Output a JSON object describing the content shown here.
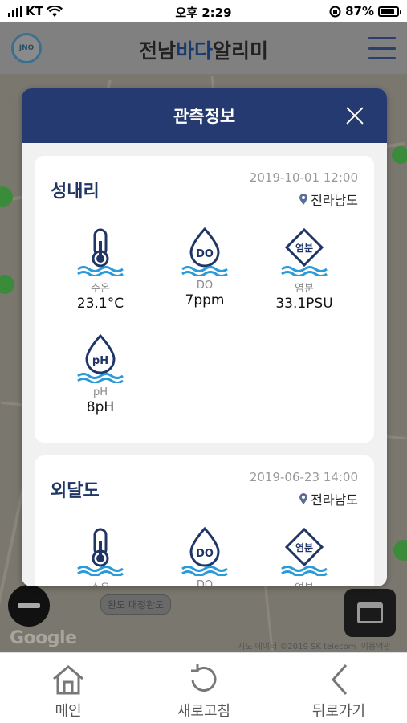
{
  "status_bar": {
    "carrier": "KT",
    "time": "오후 2:29",
    "battery": "87%",
    "battery_level": 0.87
  },
  "app": {
    "title_part1": "전남",
    "title_part2": "바다",
    "title_part3": "알리미",
    "logo_text": "JNO"
  },
  "map": {
    "google": "Google",
    "copyright": "지도 데이터 ©2019 SK telecom",
    "terms": "이용약관",
    "location_label": "완도 대청완도"
  },
  "modal": {
    "title": "관측정보",
    "cards": [
      {
        "name": "성내리",
        "datetime": "2019-10-01 12:00",
        "region": "전라남도",
        "metrics": [
          {
            "icon": "thermometer-icon",
            "label": "수온",
            "value": "23.1°C"
          },
          {
            "icon": "do-drop-icon",
            "label": "DO",
            "value": "7ppm"
          },
          {
            "icon": "salinity-icon",
            "label": "염분",
            "value": "33.1PSU"
          },
          {
            "icon": "ph-drop-icon",
            "label": "pH",
            "value": "8pH"
          }
        ]
      },
      {
        "name": "외달도",
        "datetime": "2019-06-23 14:00",
        "region": "전라남도",
        "metrics": [
          {
            "icon": "thermometer-icon",
            "label": "수온"
          },
          {
            "icon": "do-drop-icon",
            "label": "DO"
          },
          {
            "icon": "salinity-icon",
            "label": "염분"
          }
        ]
      }
    ],
    "icon_text": {
      "do": "DO",
      "salinity": "염분",
      "ph": "pH"
    }
  },
  "bottom_nav": {
    "home": "메인",
    "refresh": "새로고침",
    "back": "뒤로가기"
  },
  "colors": {
    "header": "#243a70",
    "accent": "#183a6e",
    "wave": "#2a9ad8"
  }
}
